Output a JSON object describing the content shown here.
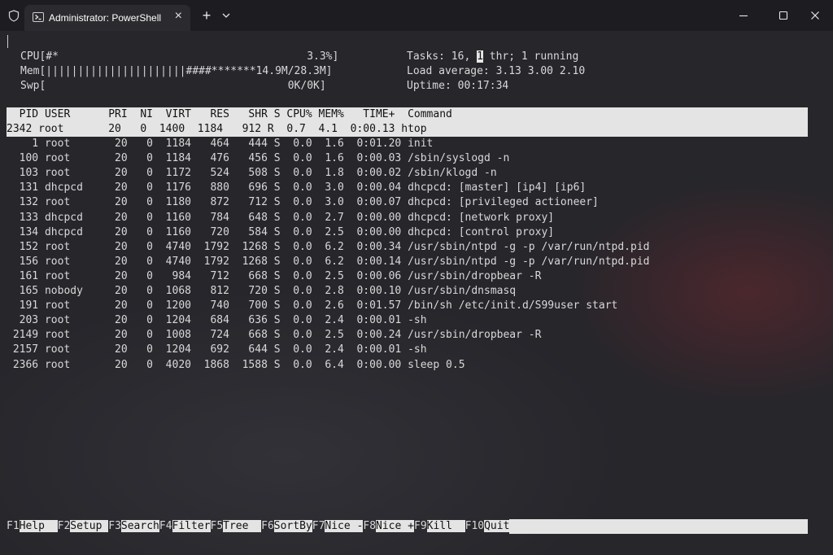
{
  "window": {
    "tab_title": "Administrator: PowerShell",
    "icons": {
      "shield": "shield-icon",
      "powershell": "powershell-icon",
      "close_tab": "close-icon",
      "new_tab": "plus-icon",
      "dropdown": "chevron-down-icon",
      "minimize": "minimize-icon",
      "maximize": "maximize-icon",
      "close": "close-icon"
    }
  },
  "htop": {
    "meters": {
      "cpu": "CPU[#*                                       3.3%]",
      "mem": "Mem[||||||||||||||||||||||####*******14.9M/28.3M]",
      "swp": "Swp[                                      0K/0K]"
    },
    "tasks_prefix": "Tasks: 16, ",
    "tasks_highlight": "1",
    "tasks_suffix": " thr; 1 running",
    "load": "Load average: 3.13 3.00 2.10",
    "uptime": "Uptime: 00:17:34",
    "header": "  PID USER      PRI  NI  VIRT   RES   SHR S CPU% MEM%   TIME+  Command",
    "rows": [
      "2342 root       20   0  1400  1184   912 R  0.7  4.1  0:00.13 htop",
      "    1 root       20   0  1184   464   444 S  0.0  1.6  0:01.20 init",
      "  100 root       20   0  1184   476   456 S  0.0  1.6  0:00.03 /sbin/syslogd -n",
      "  103 root       20   0  1172   524   508 S  0.0  1.8  0:00.02 /sbin/klogd -n",
      "  131 dhcpcd     20   0  1176   880   696 S  0.0  3.0  0:00.04 dhcpcd: [master] [ip4] [ip6]",
      "  132 root       20   0  1180   872   712 S  0.0  3.0  0:00.07 dhcpcd: [privileged actioneer]",
      "  133 dhcpcd     20   0  1160   784   648 S  0.0  2.7  0:00.00 dhcpcd: [network proxy]",
      "  134 dhcpcd     20   0  1160   720   584 S  0.0  2.5  0:00.00 dhcpcd: [control proxy]",
      "  152 root       20   0  4740  1792  1268 S  0.0  6.2  0:00.34 /usr/sbin/ntpd -g -p /var/run/ntpd.pid",
      "  156 root       20   0  4740  1792  1268 S  0.0  6.2  0:00.14 /usr/sbin/ntpd -g -p /var/run/ntpd.pid",
      "  161 root       20   0   984   712   668 S  0.0  2.5  0:00.06 /usr/sbin/dropbear -R",
      "  165 nobody     20   0  1068   812   720 S  0.0  2.8  0:00.10 /usr/sbin/dnsmasq",
      "  191 root       20   0  1200   740   700 S  0.0  2.6  0:01.57 /bin/sh /etc/init.d/S99user start",
      "  203 root       20   0  1204   684   636 S  0.0  2.4  0:00.01 -sh",
      " 2149 root       20   0  1008   724   668 S  0.0  2.5  0:00.24 /usr/sbin/dropbear -R",
      " 2157 root       20   0  1204   692   644 S  0.0  2.4  0:00.01 -sh",
      " 2366 root       20   0  4020  1868  1588 S  0.0  6.4  0:00.00 sleep 0.5"
    ],
    "footer": [
      {
        "key": "F1",
        "label": "Help  "
      },
      {
        "key": "F2",
        "label": "Setup "
      },
      {
        "key": "F3",
        "label": "Search"
      },
      {
        "key": "F4",
        "label": "Filter"
      },
      {
        "key": "F5",
        "label": "Tree  "
      },
      {
        "key": "F6",
        "label": "SortBy"
      },
      {
        "key": "F7",
        "label": "Nice -"
      },
      {
        "key": "F8",
        "label": "Nice +"
      },
      {
        "key": "F9",
        "label": "Kill  "
      },
      {
        "key": "F10",
        "label": "Quit"
      }
    ]
  }
}
